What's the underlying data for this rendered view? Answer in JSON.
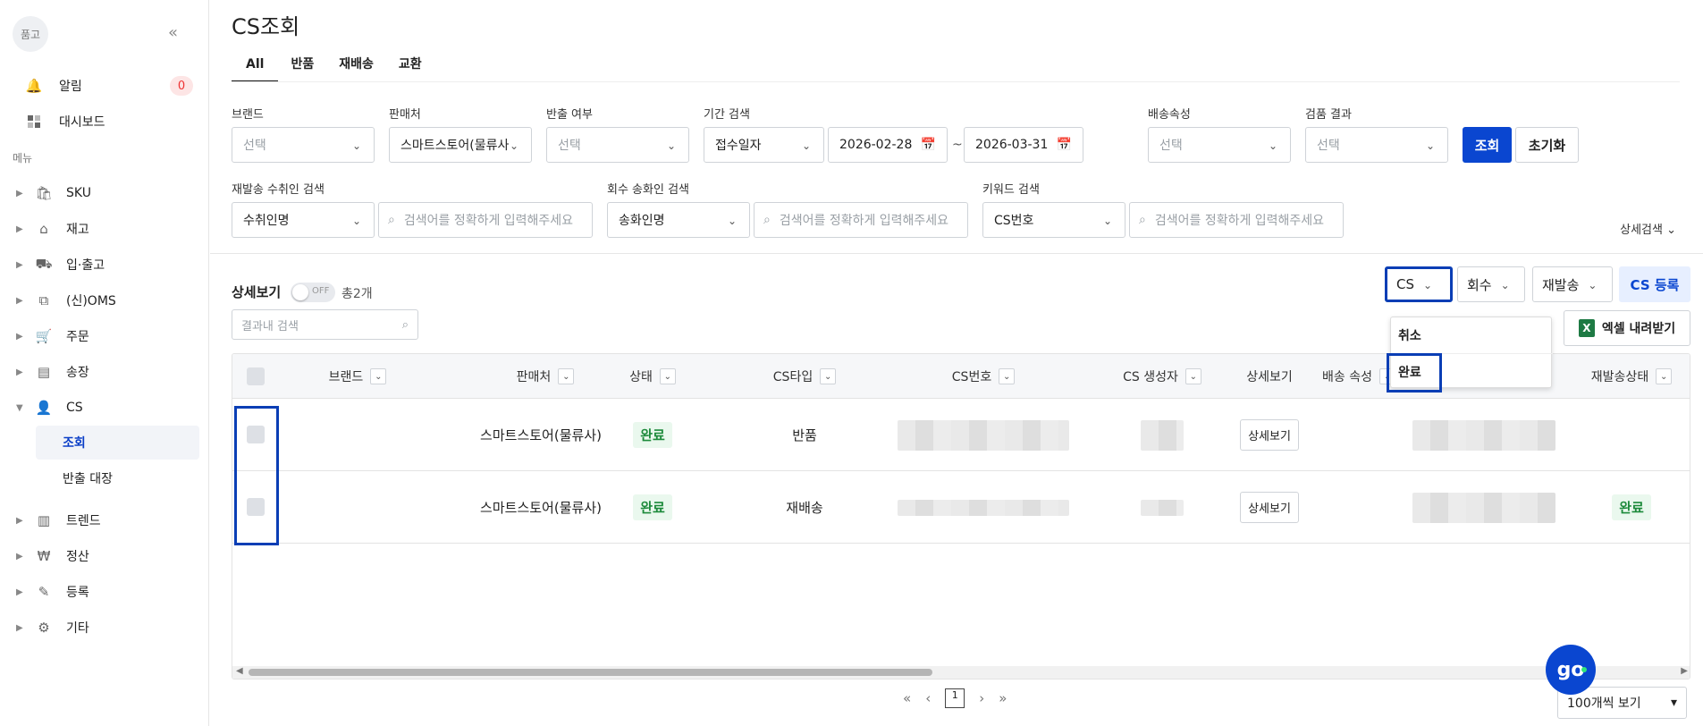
{
  "sidebar": {
    "avatar": "품고",
    "collapse": "«",
    "alerts": {
      "label": "알림",
      "count": "0"
    },
    "dashboard": "대시보드",
    "menu_label": "메뉴",
    "items": [
      {
        "label": "SKU",
        "icon": "bag-icon"
      },
      {
        "label": "재고",
        "icon": "warehouse-icon"
      },
      {
        "label": "입·출고",
        "icon": "truck-icon"
      },
      {
        "label": "(신)OMS",
        "icon": "oms-icon"
      },
      {
        "label": "주문",
        "icon": "cart-icon"
      },
      {
        "label": "송장",
        "icon": "invoice-icon"
      },
      {
        "label": "CS",
        "icon": "user-icon"
      },
      {
        "label": "트렌드",
        "icon": "chart-icon"
      },
      {
        "label": "정산",
        "icon": "won-icon"
      },
      {
        "label": "등록",
        "icon": "pen-icon"
      },
      {
        "label": "기타",
        "icon": "gear-icon"
      }
    ],
    "cs_sub": [
      "조회",
      "반출 대장"
    ]
  },
  "page": {
    "title": "CS조회",
    "tabs": [
      "All",
      "반품",
      "재배송",
      "교환"
    ]
  },
  "filters": {
    "brand": {
      "label": "브랜드",
      "value": "선택"
    },
    "seller": {
      "label": "판매처",
      "value": "스마트스토어(물류사"
    },
    "return": {
      "label": "반출 여부",
      "value": "선택"
    },
    "period": {
      "label": "기간 검색",
      "type": "접수일자",
      "from": "2026-02-28",
      "tilde": "~",
      "to": "2026-03-31"
    },
    "ship_attr": {
      "label": "배송속성",
      "value": "선택"
    },
    "inspect": {
      "label": "검품 결과",
      "value": "선택"
    },
    "search_btn": "조회",
    "reset_btn": "초기화",
    "resend": {
      "label": "재발송 수취인 검색",
      "type": "수취인명",
      "placeholder": "검색어를 정확하게 입력해주세요"
    },
    "pickup": {
      "label": "회수 송화인 검색",
      "type": "송화인명",
      "placeholder": "검색어를 정확하게 입력해주세요"
    },
    "keyword": {
      "label": "키워드 검색",
      "type": "CS번호",
      "placeholder": "검색어를 정확하게 입력해주세요"
    },
    "advanced": "상세검색"
  },
  "list": {
    "detail_view": "상세보기",
    "toggle": "OFF",
    "total": "총2개",
    "result_search_placeholder": "결과내 검색",
    "cs_filter": "CS",
    "pickup_filter": "회수",
    "resend_filter": "재발송",
    "cs_register": "CS 등록",
    "excel": "엑셀 내려받기",
    "dropdown": [
      "취소",
      "완료"
    ]
  },
  "table": {
    "headers": [
      "브랜드",
      "판매처",
      "상태",
      "CS타입",
      "CS번호",
      "CS 생성자",
      "상세보기",
      "배송 속성",
      "재발송상태"
    ],
    "rows": [
      {
        "seller": "스마트스토어(물류사)",
        "status": "완료",
        "type": "반품",
        "detail": "상세보기",
        "resend_status": ""
      },
      {
        "seller": "스마트스토어(물류사)",
        "status": "완료",
        "type": "재배송",
        "detail": "상세보기",
        "resend_status": "완료"
      }
    ]
  },
  "pager": {
    "first": "«",
    "prev": "‹",
    "page": "1",
    "next": "›",
    "last": "»"
  },
  "per_page": "100개씩 보기",
  "go_button": "go",
  "colors": {
    "primary": "#0a46d0",
    "highlight": "#0a3eb5",
    "success": "#1d8a3b",
    "alert": "#e33333"
  }
}
